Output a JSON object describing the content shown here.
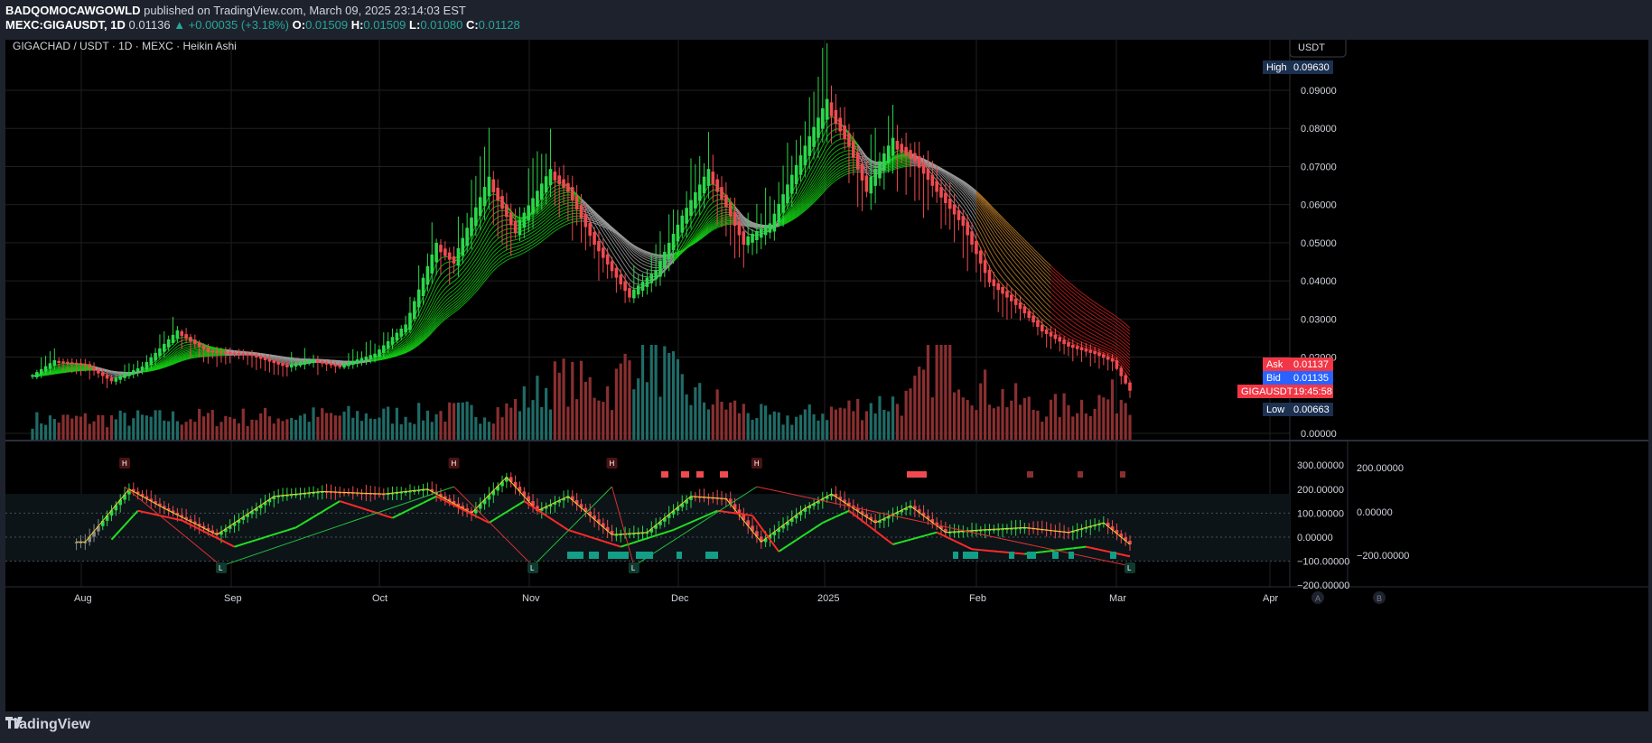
{
  "header": {
    "author": "BADQOMOCAWGOWLD",
    "published_text": "published on TradingView.com, March 09, 2025 23:14:03 EST",
    "symbol": "MEXC:GIGAUSDT, 1D",
    "last": "0.01136",
    "change": "▲ +0.00035 (+3.18%)",
    "o_label": "O:",
    "o": "0.01509",
    "h_label": "H:",
    "h": "0.01509",
    "l_label": "L:",
    "l": "0.01080",
    "c_label": "C:",
    "c": "0.01128"
  },
  "legend_title": "GIGACHAD / USDT · 1D · MEXC · Heikin Ashi",
  "currency_button": "USDT",
  "footer_brand": "TradingView",
  "scale_toggles": [
    "A",
    "B"
  ],
  "colors": {
    "background": "#000000",
    "up": "#26a69a",
    "candle_up": "#2ad84a",
    "candle_down": "#f04a50",
    "ribbon_green": "#14c814",
    "ribbon_gray": "#9a9a9a",
    "ribbon_red": "#c81e1e",
    "ask": "#f23645",
    "bid": "#2962ff",
    "badge": "#1c3050"
  },
  "chart_data": [
    {
      "type": "candlestick",
      "title": "GIGACHAD / USDT · 1D · MEXC · Heikin Ashi",
      "x_ticks": [
        "Aug",
        "Sep",
        "Oct",
        "Nov",
        "Dec",
        "2025",
        "Feb",
        "Mar",
        "Apr"
      ],
      "y_ticks": [
        "0.09000",
        "0.08000",
        "0.07000",
        "0.06000",
        "0.05000",
        "0.04000",
        "0.03000",
        "0.02000",
        "0.00000"
      ],
      "ylim": [
        0,
        0.0963
      ],
      "price_labels": [
        {
          "label": "High",
          "value": "0.09630"
        },
        {
          "label": "Ask",
          "value": "0.01137"
        },
        {
          "label": "Bid",
          "value": "0.01135"
        },
        {
          "label": "GIGAUSDT",
          "value": "0.01128",
          "timer": "19:45:58"
        },
        {
          "label": "Low",
          "value": "0.00663"
        }
      ],
      "price_anchors": [
        {
          "day": 0,
          "value": 0.015
        },
        {
          "day": 5,
          "value": 0.0188
        },
        {
          "day": 12,
          "value": 0.018
        },
        {
          "day": 18,
          "value": 0.0138
        },
        {
          "day": 25,
          "value": 0.0172
        },
        {
          "day": 33,
          "value": 0.0265
        },
        {
          "day": 40,
          "value": 0.0215
        },
        {
          "day": 50,
          "value": 0.0205
        },
        {
          "day": 58,
          "value": 0.0175
        },
        {
          "day": 64,
          "value": 0.019
        },
        {
          "day": 70,
          "value": 0.0175
        },
        {
          "day": 78,
          "value": 0.0205
        },
        {
          "day": 85,
          "value": 0.028
        },
        {
          "day": 92,
          "value": 0.049
        },
        {
          "day": 96,
          "value": 0.045
        },
        {
          "day": 104,
          "value": 0.066
        },
        {
          "day": 110,
          "value": 0.053
        },
        {
          "day": 118,
          "value": 0.068
        },
        {
          "day": 122,
          "value": 0.064
        },
        {
          "day": 128,
          "value": 0.05
        },
        {
          "day": 136,
          "value": 0.036
        },
        {
          "day": 142,
          "value": 0.042
        },
        {
          "day": 148,
          "value": 0.056
        },
        {
          "day": 154,
          "value": 0.068
        },
        {
          "day": 158,
          "value": 0.06
        },
        {
          "day": 162,
          "value": 0.05
        },
        {
          "day": 168,
          "value": 0.054
        },
        {
          "day": 176,
          "value": 0.074
        },
        {
          "day": 181,
          "value": 0.086
        },
        {
          "day": 186,
          "value": 0.076
        },
        {
          "day": 190,
          "value": 0.064
        },
        {
          "day": 196,
          "value": 0.076
        },
        {
          "day": 201,
          "value": 0.072
        },
        {
          "day": 206,
          "value": 0.064
        },
        {
          "day": 212,
          "value": 0.055
        },
        {
          "day": 218,
          "value": 0.04
        },
        {
          "day": 225,
          "value": 0.033
        },
        {
          "day": 230,
          "value": 0.027
        },
        {
          "day": 236,
          "value": 0.023
        },
        {
          "day": 242,
          "value": 0.021
        },
        {
          "day": 246,
          "value": 0.019
        },
        {
          "day": 250,
          "value": 0.0113
        }
      ],
      "volume_anchors": [
        {
          "day": 0,
          "value": 0.2
        },
        {
          "day": 85,
          "value": 0.25
        },
        {
          "day": 108,
          "value": 0.3
        },
        {
          "day": 120,
          "value": 0.6
        },
        {
          "day": 132,
          "value": 0.5
        },
        {
          "day": 138,
          "value": 0.95
        },
        {
          "day": 150,
          "value": 0.45
        },
        {
          "day": 170,
          "value": 0.2
        },
        {
          "day": 190,
          "value": 0.35
        },
        {
          "day": 200,
          "value": 0.4
        },
        {
          "day": 208,
          "value": 0.95
        },
        {
          "day": 214,
          "value": 0.55
        },
        {
          "day": 230,
          "value": 0.3
        },
        {
          "day": 250,
          "value": 0.45
        }
      ]
    },
    {
      "type": "line",
      "name": "oscillator",
      "y_ticks": [
        "300.00000",
        "200.00000",
        "100.00000",
        "0.00000",
        "−100.00000",
        "−200.00000"
      ],
      "y_ticks_right": [
        "200.00000",
        "0.00000",
        "−200.00000"
      ],
      "ylim": [
        -200,
        300
      ],
      "fast_anchors": [
        {
          "day": 12,
          "value": -20
        },
        {
          "day": 22,
          "value": 200
        },
        {
          "day": 30,
          "value": 120
        },
        {
          "day": 42,
          "value": 10
        },
        {
          "day": 55,
          "value": 170
        },
        {
          "day": 66,
          "value": 190
        },
        {
          "day": 80,
          "value": 180
        },
        {
          "day": 90,
          "value": 200
        },
        {
          "day": 100,
          "value": 100
        },
        {
          "day": 108,
          "value": 250
        },
        {
          "day": 115,
          "value": 110
        },
        {
          "day": 122,
          "value": 170
        },
        {
          "day": 132,
          "value": 10
        },
        {
          "day": 140,
          "value": 20
        },
        {
          "day": 150,
          "value": 170
        },
        {
          "day": 158,
          "value": 160
        },
        {
          "day": 166,
          "value": -20
        },
        {
          "day": 176,
          "value": 120
        },
        {
          "day": 182,
          "value": 180
        },
        {
          "day": 192,
          "value": 60
        },
        {
          "day": 200,
          "value": 130
        },
        {
          "day": 208,
          "value": 20
        },
        {
          "day": 216,
          "value": 30
        },
        {
          "day": 226,
          "value": 40
        },
        {
          "day": 236,
          "value": 20
        },
        {
          "day": 244,
          "value": 60
        },
        {
          "day": 250,
          "value": -30
        }
      ],
      "slow_anchors": [
        {
          "day": 18,
          "value": -10
        },
        {
          "day": 24,
          "value": 110
        },
        {
          "day": 34,
          "value": 70
        },
        {
          "day": 46,
          "value": -40
        },
        {
          "day": 60,
          "value": 40
        },
        {
          "day": 70,
          "value": 150
        },
        {
          "day": 82,
          "value": 80
        },
        {
          "day": 92,
          "value": 170
        },
        {
          "day": 104,
          "value": 60
        },
        {
          "day": 112,
          "value": 150
        },
        {
          "day": 122,
          "value": 30
        },
        {
          "day": 134,
          "value": -40
        },
        {
          "day": 146,
          "value": 30
        },
        {
          "day": 156,
          "value": 110
        },
        {
          "day": 164,
          "value": 90
        },
        {
          "day": 170,
          "value": -60
        },
        {
          "day": 180,
          "value": 60
        },
        {
          "day": 186,
          "value": 110
        },
        {
          "day": 196,
          "value": -30
        },
        {
          "day": 206,
          "value": 20
        },
        {
          "day": 214,
          "value": -50
        },
        {
          "day": 226,
          "value": -70
        },
        {
          "day": 240,
          "value": -40
        },
        {
          "day": 250,
          "value": -80
        }
      ],
      "pivots": [
        {
          "type": "H",
          "day": 21
        },
        {
          "type": "L",
          "day": 43
        },
        {
          "type": "H",
          "day": 96
        },
        {
          "type": "L",
          "day": 114
        },
        {
          "type": "H",
          "day": 132
        },
        {
          "type": "L",
          "day": 137
        },
        {
          "type": "H",
          "day": 165
        },
        {
          "type": "L",
          "day": 250
        }
      ]
    }
  ]
}
